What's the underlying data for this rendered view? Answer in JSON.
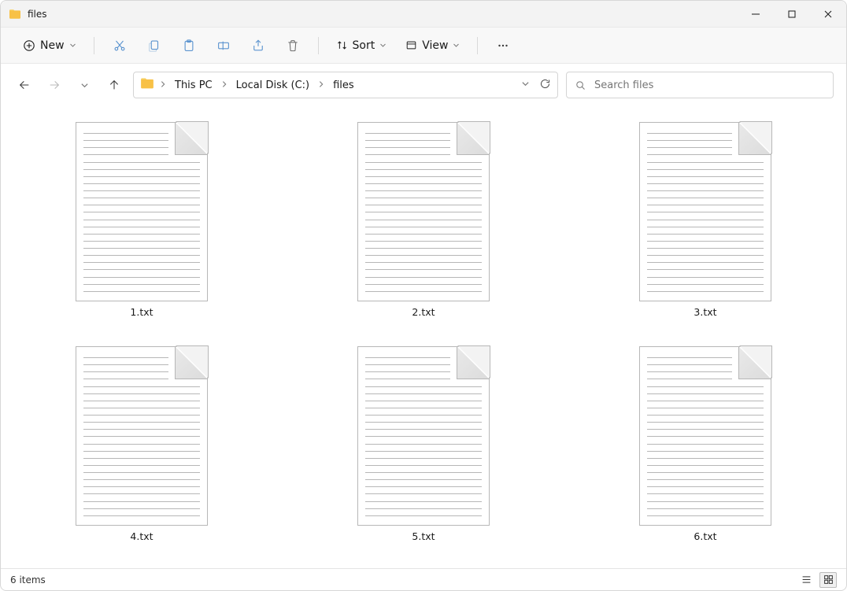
{
  "window": {
    "title": "files"
  },
  "toolbar": {
    "new_label": "New",
    "sort_label": "Sort",
    "view_label": "View"
  },
  "breadcrumb": {
    "parts": [
      "This PC",
      "Local Disk (C:)",
      "files"
    ]
  },
  "search": {
    "placeholder": "Search files"
  },
  "files": [
    {
      "name": "1.txt"
    },
    {
      "name": "2.txt"
    },
    {
      "name": "3.txt"
    },
    {
      "name": "4.txt"
    },
    {
      "name": "5.txt"
    },
    {
      "name": "6.txt"
    }
  ],
  "status": {
    "text": "6 items"
  }
}
